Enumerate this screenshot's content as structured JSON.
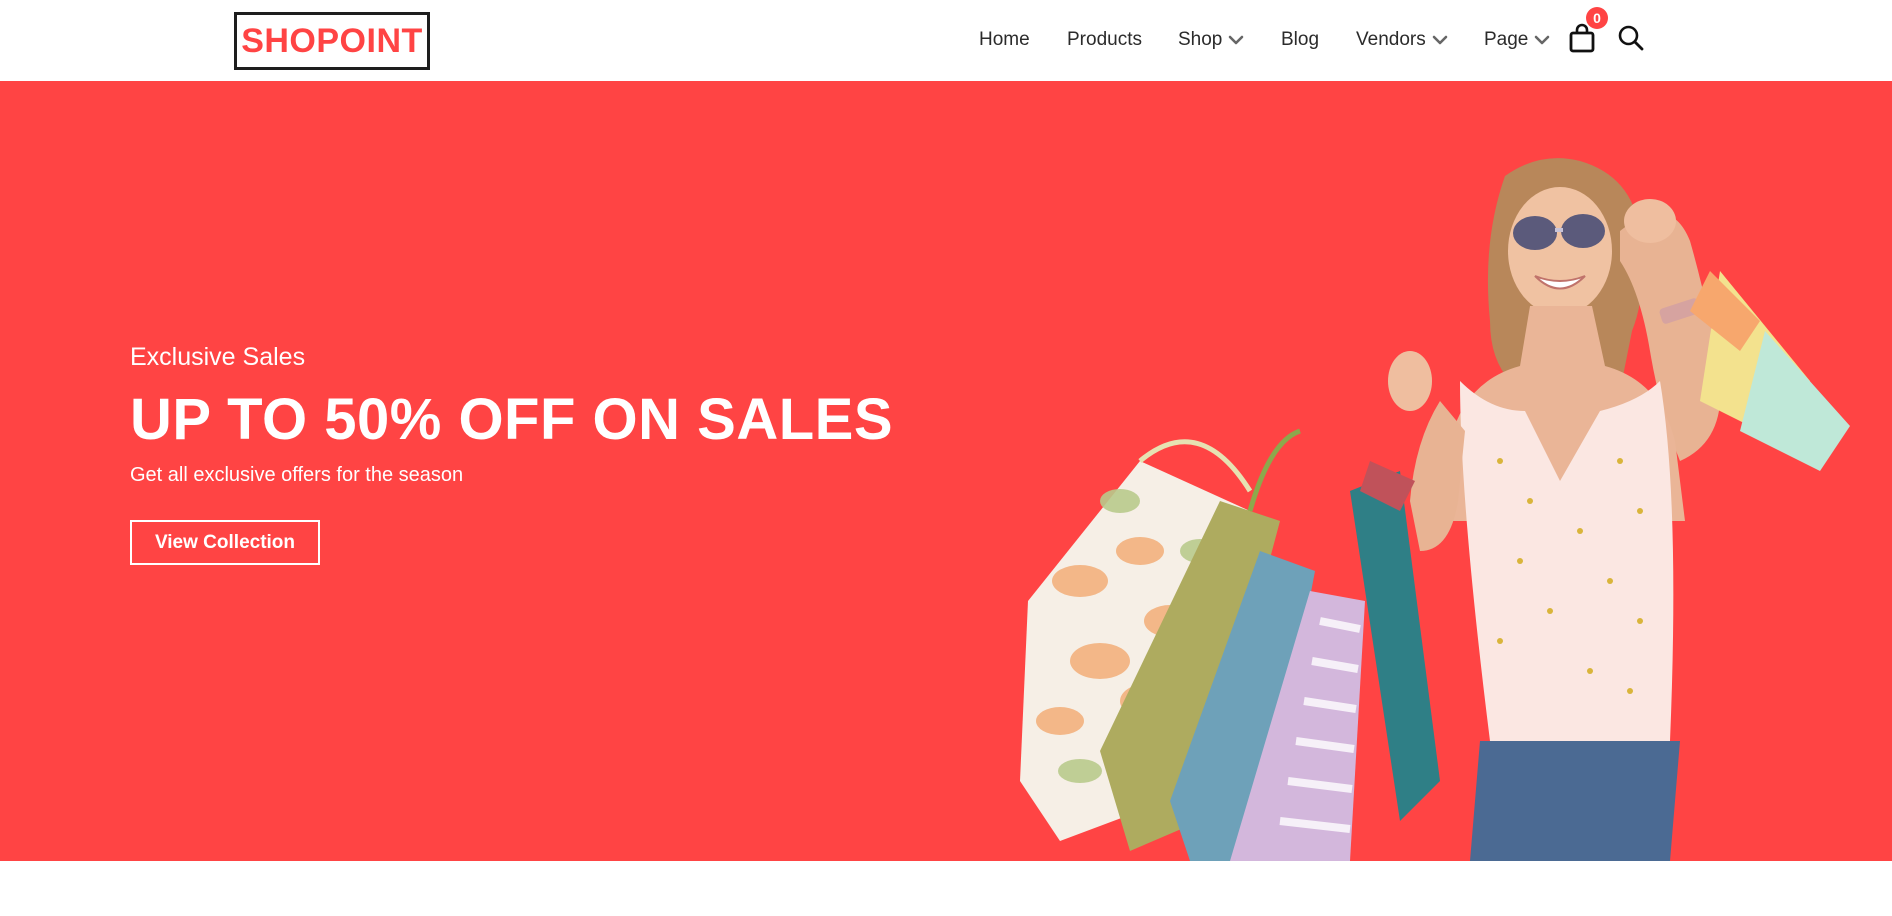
{
  "brand": {
    "logo_text": "SHOPOINT",
    "accent": "#ff4444"
  },
  "nav": {
    "items": [
      {
        "label": "Home",
        "dropdown": false
      },
      {
        "label": "Products",
        "dropdown": false
      },
      {
        "label": "Shop",
        "dropdown": true
      },
      {
        "label": "Blog",
        "dropdown": false
      },
      {
        "label": "Vendors",
        "dropdown": true
      },
      {
        "label": "Page",
        "dropdown": true
      }
    ],
    "cart_count": "0",
    "icons": [
      "shopping-bag-icon",
      "search-icon"
    ]
  },
  "hero": {
    "kicker": "Exclusive Sales",
    "title": "UP TO 50% OFF ON SALES",
    "subtitle": "Get all exclusive offers for the season",
    "cta_label": "View Collection",
    "background": "#ff4444"
  }
}
